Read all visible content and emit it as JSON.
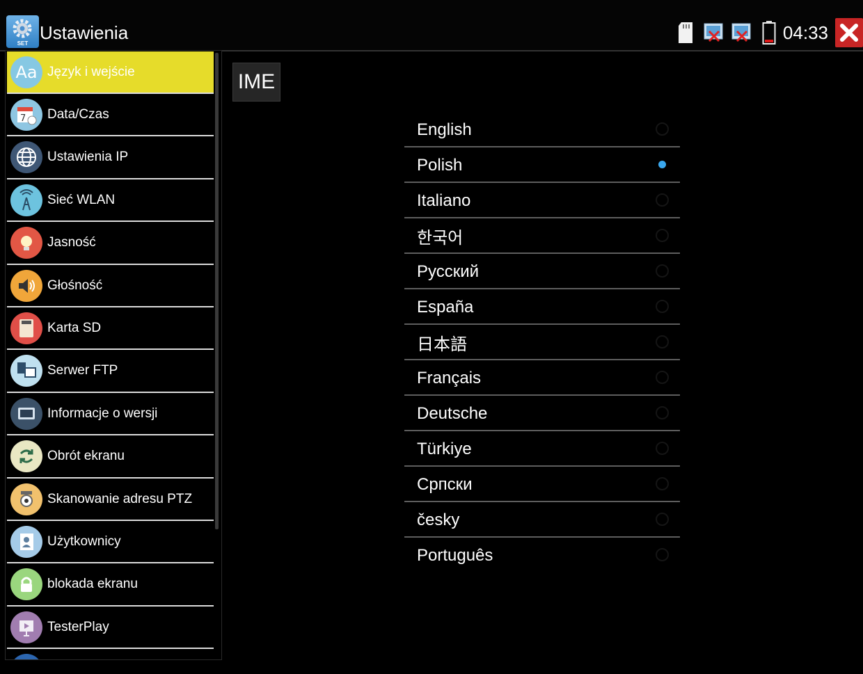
{
  "app": {
    "icon_label": "SET",
    "title": "Ustawienia"
  },
  "status": {
    "time": "04:33"
  },
  "sidebar": {
    "items": [
      {
        "label": "Język i wejście",
        "icon": "text-aa-icon",
        "color": "#86c8e3",
        "active": true
      },
      {
        "label": "Data/Czas",
        "icon": "calendar-clock-icon",
        "color": "#8ec6e2"
      },
      {
        "label": "Ustawienia IP",
        "icon": "globe-icon",
        "color": "#3f5775"
      },
      {
        "label": "Sieć WLAN",
        "icon": "wlan-antenna-icon",
        "color": "#6dc3df"
      },
      {
        "label": "Jasność",
        "icon": "bulb-icon",
        "color": "#e25745"
      },
      {
        "label": "Głośność",
        "icon": "speaker-icon",
        "color": "#f0a63a"
      },
      {
        "label": "Karta SD",
        "icon": "sd-card-icon",
        "color": "#e04f48"
      },
      {
        "label": "Serwer FTP",
        "icon": "ftp-server-icon",
        "color": "#bfe0ef"
      },
      {
        "label": "Informacje o wersji",
        "icon": "monitor-icon",
        "color": "#3b5168"
      },
      {
        "label": "Obrót ekranu",
        "icon": "rotate-icon",
        "color": "#e9e7c3"
      },
      {
        "label": "Skanowanie adresu PTZ",
        "icon": "ptz-camera-icon",
        "color": "#f1c16d"
      },
      {
        "label": "Użytkownicy",
        "icon": "contacts-icon",
        "color": "#a5cbe8"
      },
      {
        "label": "blokada ekranu",
        "icon": "lock-icon",
        "color": "#9ad67e"
      },
      {
        "label": "TesterPlay",
        "icon": "play-screen-icon",
        "color": "#a17db0"
      },
      {
        "label": "",
        "icon": "partial-icon",
        "color": "#2c66b0"
      }
    ]
  },
  "main": {
    "ime_label": "IME",
    "languages": [
      {
        "name": "English",
        "selected": false
      },
      {
        "name": "Polish",
        "selected": true
      },
      {
        "name": "Italiano",
        "selected": false
      },
      {
        "name": "한국어",
        "selected": false
      },
      {
        "name": "Русский",
        "selected": false
      },
      {
        "name": "España",
        "selected": false
      },
      {
        "name": "日本語",
        "selected": false
      },
      {
        "name": "Français",
        "selected": false
      },
      {
        "name": "Deutsche",
        "selected": false
      },
      {
        "name": "Türkiye",
        "selected": false
      },
      {
        "name": "Српски",
        "selected": false
      },
      {
        "name": "česky",
        "selected": false
      },
      {
        "name": "Português",
        "selected": false
      }
    ],
    "selected_color": "#3aa8ee"
  }
}
